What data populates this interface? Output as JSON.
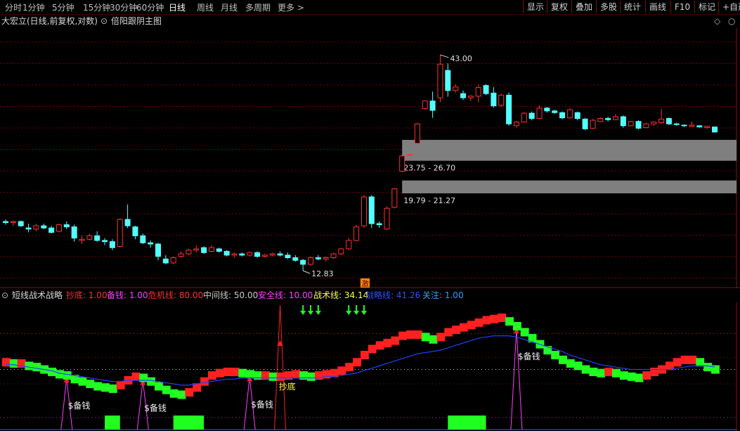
{
  "toolbar": {
    "periods": [
      "分时",
      "1分钟",
      "5分钟",
      "15分钟",
      "30分钟",
      "60分钟",
      "日线",
      "周线",
      "月线",
      "多周期",
      "更多 >"
    ],
    "active_period": "日线",
    "buttons": [
      "显示",
      "复权",
      "叠加",
      "多股",
      "统计",
      "画线",
      "F10",
      "标记",
      "+自选"
    ]
  },
  "main_panel": {
    "title": "大宏立(日线,前复权,对数)",
    "indicator_name": "倍阳跟阴主图",
    "high_label": "43.00",
    "low_label": "12.83",
    "zone_upper_label": "23.75 - 26.70",
    "zone_lower_label": "19.79 - 21.27",
    "marker_text": "激",
    "colors": {
      "up": "#ff3030",
      "down": "#54ffff",
      "zone": "#7f7f7f",
      "grid": "#7a0000"
    }
  },
  "sub_panel": {
    "name": "短线战术战略",
    "legend": [
      {
        "label": "抄底:",
        "value": "1.00",
        "color": "#ff3030"
      },
      {
        "label": "备钱:",
        "value": "1.00",
        "color": "#ff40ff"
      },
      {
        "label": "危机线:",
        "value": "80.00",
        "color": "#ff3030"
      },
      {
        "label": "中间线:",
        "value": "50.00",
        "color": "#c8c8c8"
      },
      {
        "label": "安全线:",
        "value": "10.00",
        "color": "#ff40ff"
      },
      {
        "label": "战术线:",
        "value": "34.14",
        "color": "#ffff50"
      },
      {
        "label": "战略线:",
        "value": "41.26",
        "color": "#3050ff"
      },
      {
        "label": "关注:",
        "value": "1.00",
        "color": "#30a0ff"
      }
    ],
    "signal_text_money": "$备钱",
    "signal_text_bottom": "抄底",
    "colors": {
      "bar_up": "#ff2020",
      "bar_down": "#20ff20",
      "strategy": "#2040ff",
      "money": "#ff40ff",
      "bottom": "#ff2020",
      "arrow": "#20ff20"
    }
  },
  "chart_data": {
    "type": "candlestick",
    "title": "大宏立(日线,前复权,对数)",
    "scale": "log",
    "price_range": [
      12.0,
      48.0
    ],
    "candles": [
      [
        16.9,
        17.1,
        16.6,
        16.8
      ],
      [
        16.8,
        17.0,
        16.5,
        16.9
      ],
      [
        16.9,
        17.0,
        16.4,
        16.5
      ],
      [
        16.3,
        16.7,
        15.9,
        16.2
      ],
      [
        16.2,
        16.7,
        16.0,
        16.5
      ],
      [
        16.5,
        16.7,
        16.2,
        16.3
      ],
      [
        16.3,
        16.5,
        15.8,
        15.9
      ],
      [
        16.0,
        16.7,
        15.9,
        16.6
      ],
      [
        16.6,
        16.9,
        16.2,
        16.4
      ],
      [
        16.4,
        16.6,
        15.1,
        15.4
      ],
      [
        15.2,
        15.6,
        14.9,
        15.3
      ],
      [
        15.3,
        15.8,
        15.2,
        15.6
      ],
      [
        15.6,
        16.0,
        15.1,
        15.2
      ],
      [
        15.2,
        15.4,
        14.8,
        15.1
      ],
      [
        15.1,
        15.3,
        14.4,
        14.6
      ],
      [
        14.7,
        17.2,
        14.6,
        17.1
      ],
      [
        17.1,
        18.6,
        16.3,
        16.5
      ],
      [
        16.4,
        16.5,
        15.3,
        15.6
      ],
      [
        15.6,
        15.8,
        14.9,
        15.0
      ],
      [
        15.0,
        15.2,
        14.6,
        14.9
      ],
      [
        14.9,
        15.0,
        13.6,
        13.9
      ],
      [
        13.7,
        14.0,
        13.3,
        13.4
      ],
      [
        13.4,
        13.9,
        13.3,
        13.8
      ],
      [
        13.9,
        14.3,
        13.8,
        14.1
      ],
      [
        14.1,
        14.5,
        14.0,
        14.4
      ],
      [
        14.4,
        14.8,
        14.2,
        14.5
      ],
      [
        14.6,
        14.7,
        14.1,
        14.2
      ],
      [
        14.3,
        14.8,
        14.2,
        14.6
      ],
      [
        14.5,
        14.6,
        14.2,
        14.3
      ],
      [
        14.3,
        14.4,
        13.9,
        14.0
      ],
      [
        14.0,
        14.2,
        13.8,
        14.1
      ],
      [
        14.1,
        14.2,
        13.9,
        14.0
      ],
      [
        14.0,
        14.3,
        13.9,
        14.2
      ],
      [
        14.2,
        14.3,
        13.8,
        13.9
      ],
      [
        13.9,
        14.1,
        13.8,
        14.0
      ],
      [
        14.0,
        14.2,
        13.9,
        14.1
      ],
      [
        14.1,
        14.3,
        13.9,
        14.0
      ],
      [
        14.0,
        14.2,
        13.7,
        13.8
      ],
      [
        13.8,
        14.0,
        13.5,
        13.6
      ],
      [
        13.6,
        13.7,
        12.83,
        13.3
      ],
      [
        13.3,
        13.9,
        13.2,
        13.8
      ],
      [
        13.8,
        14.0,
        13.6,
        13.7
      ],
      [
        13.7,
        13.9,
        13.5,
        13.8
      ],
      [
        13.8,
        14.2,
        13.7,
        14.1
      ],
      [
        14.1,
        14.6,
        14.0,
        14.5
      ],
      [
        14.5,
        15.4,
        14.4,
        15.2
      ],
      [
        15.2,
        16.6,
        15.1,
        16.4
      ],
      [
        16.5,
        19.6,
        16.3,
        19.4
      ],
      [
        19.4,
        19.6,
        16.3,
        16.7
      ],
      [
        16.7,
        16.9,
        16.3,
        16.6
      ],
      [
        16.2,
        18.4,
        16.1,
        18.2
      ],
      [
        18.3,
        20.4,
        18.2,
        20.3
      ],
      [
        22.4,
        24.6,
        22.3,
        24.4
      ],
      [
        24.5,
        24.6,
        24.4,
        24.6
      ],
      [
        26.2,
        29.4,
        26.0,
        29.2
      ],
      [
        31.8,
        33.3,
        31.6,
        33.2
      ],
      [
        33.2,
        35.0,
        30.2,
        31.5
      ],
      [
        33.8,
        43.0,
        33.0,
        40.8
      ],
      [
        39.4,
        41.0,
        34.0,
        35.2
      ],
      [
        35.2,
        36.5,
        34.8,
        35.9
      ],
      [
        34.6,
        35.2,
        33.4,
        33.8
      ],
      [
        33.8,
        34.3,
        33.2,
        34.1
      ],
      [
        34.1,
        36.4,
        33.0,
        35.8
      ],
      [
        36.2,
        36.5,
        34.3,
        34.6
      ],
      [
        34.7,
        35.9,
        32.0,
        32.3
      ],
      [
        32.4,
        34.6,
        32.1,
        34.3
      ],
      [
        34.3,
        34.8,
        28.9,
        29.2
      ],
      [
        28.9,
        29.7,
        28.6,
        29.5
      ],
      [
        29.5,
        31.2,
        29.4,
        31.0
      ],
      [
        31.0,
        31.3,
        29.8,
        30.1
      ],
      [
        30.1,
        32.4,
        30.0,
        31.9
      ],
      [
        31.9,
        32.1,
        31.1,
        31.4
      ],
      [
        31.4,
        31.6,
        30.9,
        31.1
      ],
      [
        31.1,
        31.3,
        30.0,
        30.2
      ],
      [
        30.2,
        31.9,
        30.1,
        31.6
      ],
      [
        31.1,
        31.3,
        29.8,
        30.1
      ],
      [
        30.0,
        30.2,
        28.2,
        28.4
      ],
      [
        28.5,
        30.0,
        28.4,
        29.8
      ],
      [
        29.6,
        30.3,
        29.5,
        30.1
      ],
      [
        30.1,
        30.4,
        29.6,
        29.9
      ],
      [
        29.9,
        30.9,
        29.8,
        30.4
      ],
      [
        30.4,
        30.6,
        28.6,
        28.9
      ],
      [
        28.9,
        29.7,
        28.8,
        29.6
      ],
      [
        29.6,
        29.8,
        28.3,
        28.5
      ],
      [
        28.6,
        29.4,
        28.5,
        29.2
      ],
      [
        29.2,
        29.6,
        28.9,
        29.5
      ],
      [
        29.4,
        31.8,
        29.2,
        30.0
      ],
      [
        30.1,
        30.3,
        29.0,
        29.2
      ],
      [
        29.2,
        29.4,
        28.9,
        29.1
      ],
      [
        29.0,
        29.1,
        28.7,
        28.9
      ],
      [
        28.8,
        29.6,
        28.7,
        29.0
      ],
      [
        28.9,
        29.0,
        28.6,
        28.7
      ],
      [
        28.6,
        28.9,
        28.4,
        28.8
      ],
      [
        28.7,
        28.8,
        27.8,
        27.9
      ]
    ],
    "zones": [
      {
        "label": "23.75 - 26.70",
        "low": 23.75,
        "high": 26.7
      },
      {
        "label": "19.79 - 21.27",
        "low": 19.79,
        "high": 21.27
      }
    ],
    "sub_indicator": {
      "range": [
        0,
        100
      ],
      "reference_lines": {
        "危机线": 80,
        "中间线": 50,
        "安全线": 10
      },
      "tactic_line": [
        56,
        55,
        55,
        53,
        52,
        50,
        48,
        46,
        45,
        42,
        40,
        38,
        36,
        35,
        34,
        37,
        41,
        44,
        43,
        40,
        36,
        33,
        30,
        29,
        31,
        35,
        40,
        45,
        47,
        48,
        48,
        47,
        46,
        45,
        45,
        44,
        44,
        45,
        46,
        45,
        44,
        45,
        46,
        47,
        49,
        52,
        56,
        62,
        67,
        70,
        72,
        74,
        78,
        79,
        79,
        77,
        75,
        77,
        81,
        83,
        85,
        87,
        89,
        91,
        92,
        93,
        90,
        86,
        81,
        76,
        71,
        66,
        62,
        58,
        55,
        53,
        50,
        48,
        47,
        48,
        47,
        45,
        44,
        43,
        45,
        48,
        50,
        53,
        56,
        58,
        58,
        56,
        52,
        50,
        48,
        46,
        44,
        44,
        43
      ],
      "strategy_line": [
        54,
        54,
        53,
        52,
        51,
        50,
        49,
        47,
        46,
        45,
        44,
        43,
        42,
        41,
        40,
        40,
        41,
        41,
        41,
        41,
        40,
        39,
        38,
        37,
        37,
        38,
        39,
        40,
        41,
        42,
        42,
        43,
        43,
        43,
        43,
        43,
        43,
        43,
        43,
        43,
        43,
        43,
        44,
        44,
        45,
        46,
        47,
        49,
        51,
        53,
        55,
        57,
        59,
        61,
        63,
        64,
        65,
        66,
        68,
        70,
        72,
        74,
        76,
        77,
        78,
        78,
        78,
        77,
        75,
        73,
        71,
        69,
        67,
        65,
        62,
        60,
        58,
        56,
        54,
        53,
        52,
        51,
        50,
        50,
        50,
        50,
        50,
        50,
        51,
        52,
        53,
        53,
        53,
        52,
        51,
        51,
        50,
        50,
        49
      ],
      "money_signals": [
        8,
        18,
        32,
        67
      ],
      "bottom_signal": 36,
      "attention_signals": [
        39,
        40,
        41,
        45,
        46,
        47
      ],
      "bottom_green_blocks": [
        [
          13,
          15
        ],
        [
          22,
          26
        ],
        [
          58,
          63
        ]
      ]
    }
  }
}
